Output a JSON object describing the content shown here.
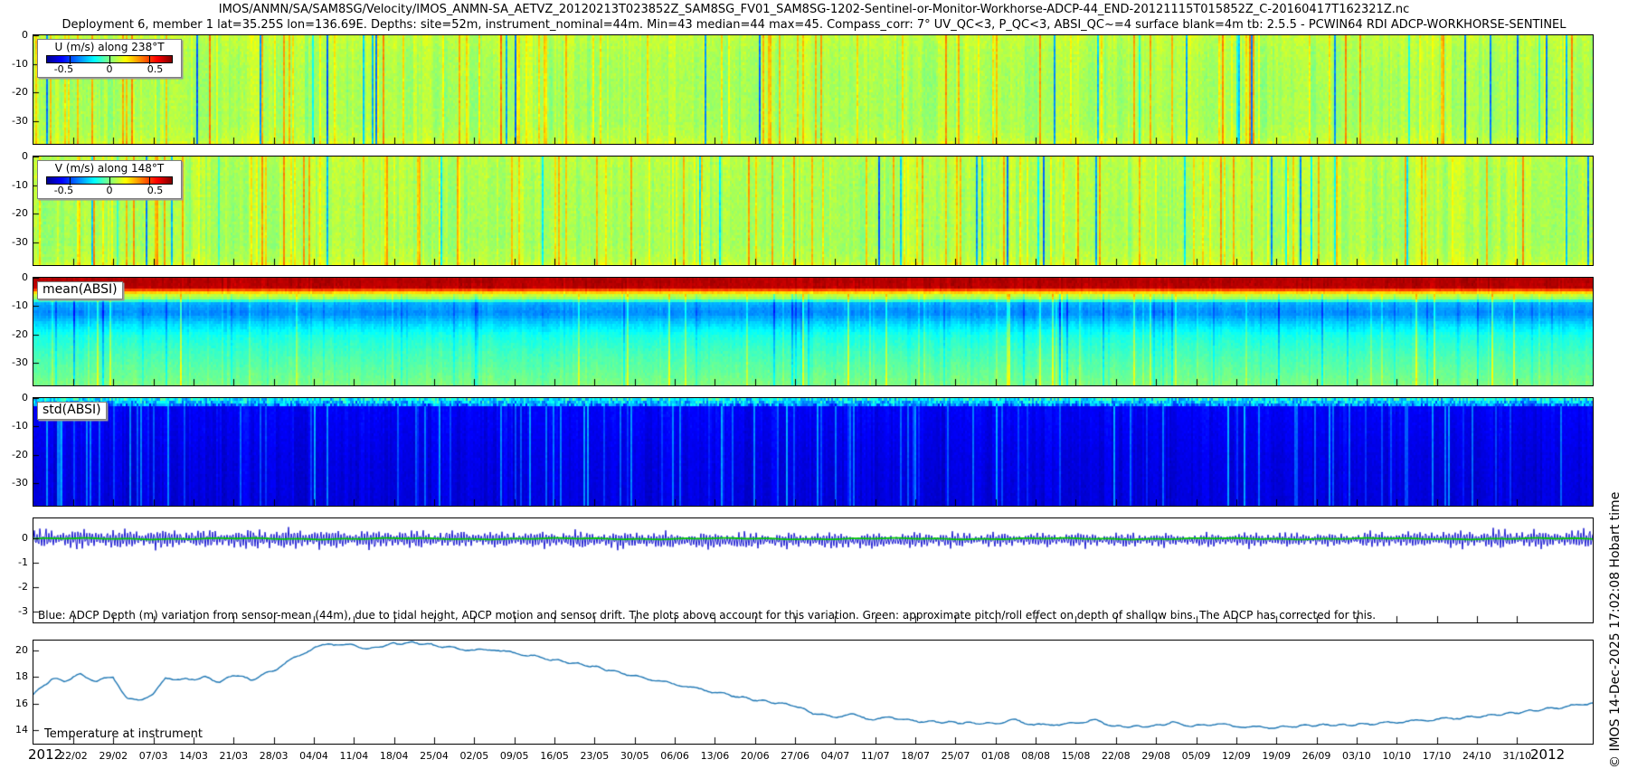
{
  "header": {
    "title": "IMOS/ANMN/SA/SAM8SG/Velocity/IMOS_ANMN-SA_AETVZ_20120213T023852Z_SAM8SG_FV01_SAM8SG-1202-Sentinel-or-Monitor-Workhorse-ADCP-44_END-20121115T015852Z_C-20160417T162321Z.nc",
    "subtitle": "Deployment 6, member 1 lat=35.25S lon=136.69E. Depths: site=52m, instrument_nominal=44m. Min=43 median=44 max=45. Compass_corr: 7° UV_QC<3, P_QC<3, ABSI_QC~=4 surface blank=4m tb: 2.5.5 - PCWIN64 RDI ADCP-WORKHORSE-SENTINEL"
  },
  "watermark": "© IMOS 14-Dec-2025 17:02:08 Hobart time",
  "xaxis": {
    "year_left": "2012",
    "year_right": "2012",
    "tick_labels": [
      "22/02",
      "29/02",
      "07/03",
      "14/03",
      "21/03",
      "28/03",
      "04/04",
      "11/04",
      "18/04",
      "25/04",
      "02/05",
      "09/05",
      "16/05",
      "23/05",
      "30/05",
      "06/06",
      "13/06",
      "20/06",
      "27/06",
      "04/07",
      "11/07",
      "18/07",
      "25/07",
      "01/08",
      "08/08",
      "15/08",
      "22/08",
      "29/08",
      "05/09",
      "12/09",
      "19/09",
      "26/09",
      "03/10",
      "10/10",
      "17/10",
      "24/10",
      "31/10"
    ]
  },
  "chart_data": [
    {
      "id": "u_velocity",
      "type": "heatmap",
      "legend": {
        "title": "U (m/s) along 238°T",
        "ticks": [
          "-0.5",
          "0",
          "0.5"
        ]
      },
      "colormap": "jet",
      "clim": [
        -0.78,
        0.78
      ],
      "ylim": [
        -38,
        0
      ],
      "yticks": [
        0,
        -10,
        -20,
        -30
      ],
      "description": "Depth-time velocity component; mostly weak positive flow (green, ~0 to 0.15 m/s) with full-depth vertical stripes of yellow/orange (~0.3-0.5 m/s) and occasional blue (-0.3 m/s) events",
      "profile": [
        [
          0,
          0.565
        ],
        [
          5,
          0.55
        ],
        [
          15,
          0.54
        ],
        [
          30,
          0.54
        ],
        [
          36,
          0.56
        ],
        [
          38,
          0.6
        ]
      ],
      "noise": {
        "seed": 101,
        "col_sd": 0.05,
        "cell_sd": 0.035,
        "p_hi": 0.1,
        "hi_amp": 0.14,
        "p_lo": 0.04,
        "lo_amp": 0.26,
        "stripe_min_depth": 0,
        "surface_depth": 0,
        "surface_noise": 0
      }
    },
    {
      "id": "v_velocity",
      "type": "heatmap",
      "legend": {
        "title": "V (m/s) along 148°T",
        "ticks": [
          "-0.5",
          "0",
          "0.5"
        ]
      },
      "colormap": "jet",
      "clim": [
        -0.78,
        0.78
      ],
      "ylim": [
        -38,
        0
      ],
      "yticks": [
        0,
        -10,
        -20,
        -30
      ],
      "description": "Depth-time velocity component; similar striped green/yellow field with sporadic orange and blue columns",
      "profile": [
        [
          0,
          0.56
        ],
        [
          5,
          0.55
        ],
        [
          15,
          0.545
        ],
        [
          30,
          0.54
        ],
        [
          36,
          0.56
        ],
        [
          38,
          0.6
        ]
      ],
      "noise": {
        "seed": 202,
        "col_sd": 0.05,
        "cell_sd": 0.035,
        "p_hi": 0.12,
        "hi_amp": 0.13,
        "p_lo": 0.03,
        "lo_amp": 0.24,
        "stripe_min_depth": 0,
        "surface_depth": 0,
        "surface_noise": 0
      }
    },
    {
      "id": "mean_absi",
      "type": "heatmap",
      "label": "mean(ABSI)",
      "colormap": "jet",
      "ylim": [
        -38,
        0
      ],
      "yticks": [
        0,
        -10,
        -20,
        -30
      ],
      "description": "Mean acoustic backscatter: dark-red surface band (0 to -4 m), thin yellow-green band (-4 to -7 m), blue/cyan minimum (-7 to -18 m), teal-green below (-18 to -38 m), all with vertical striping",
      "profile": [
        [
          0,
          0.95
        ],
        [
          3,
          0.94
        ],
        [
          4.5,
          0.7
        ],
        [
          5.5,
          0.58
        ],
        [
          7,
          0.52
        ],
        [
          8.5,
          0.3
        ],
        [
          12,
          0.26
        ],
        [
          16,
          0.34
        ],
        [
          20,
          0.4
        ],
        [
          26,
          0.44
        ],
        [
          32,
          0.47
        ],
        [
          38,
          0.5
        ]
      ],
      "noise": {
        "seed": 303,
        "col_sd": 0.03,
        "cell_sd": 0.025,
        "p_hi": 0.05,
        "hi_amp": 0.1,
        "p_lo": 0.05,
        "lo_amp": 0.08,
        "stripe_min_depth": 5,
        "surface_depth": 0,
        "surface_noise": 0
      }
    },
    {
      "id": "std_absi",
      "type": "heatmap",
      "label": "std(ABSI)",
      "colormap": "jet",
      "ylim": [
        -38,
        0
      ],
      "yticks": [
        0,
        -10,
        -20,
        -30
      ],
      "description": "Backscatter standard deviation: mostly dark blue (low) with lighter-blue vertical stripes and a mixed blue/cyan/green speckled band in the top ~2 m",
      "profile": [
        [
          0,
          0.26
        ],
        [
          1.2,
          0.2
        ],
        [
          2.5,
          0.12
        ],
        [
          20,
          0.1
        ],
        [
          38,
          0.09
        ]
      ],
      "noise": {
        "seed": 404,
        "col_sd": 0.035,
        "cell_sd": 0.02,
        "p_hi": 0.12,
        "hi_amp": 0.13,
        "p_lo": 0.0,
        "lo_amp": 0,
        "stripe_min_depth": 2.5,
        "surface_depth": 2,
        "surface_noise": 0.22
      }
    },
    {
      "id": "depth_variation",
      "type": "line",
      "ylim": [
        -3.46,
        0.84
      ],
      "yticks": [
        0,
        -1,
        -2,
        -3
      ],
      "annotation": "Blue: ADCP Depth (m) variation from sensor-mean (44m), due to tidal height, ADCP motion and sensor drift. The plots above account for this variation. Green: approximate pitch/roll effect on depth of shallow bins. The ADCP has corrected for this.",
      "series": [
        {
          "name": "ADCP depth variation (m)",
          "color": "#0000CC"
        },
        {
          "name": "approximate pitch/roll effect",
          "color": "#00C800"
        }
      ],
      "envelope": [
        [
          0,
          0.3
        ],
        [
          0.05,
          0.35
        ],
        [
          0.1,
          0.3
        ],
        [
          0.15,
          0.35
        ],
        [
          0.2,
          0.32
        ],
        [
          0.25,
          0.3
        ],
        [
          0.3,
          0.28
        ],
        [
          0.35,
          0.3
        ],
        [
          0.4,
          0.28
        ],
        [
          0.45,
          0.3
        ],
        [
          0.47,
          0.25
        ],
        [
          0.52,
          0.28
        ],
        [
          0.58,
          0.25
        ],
        [
          0.63,
          0.22
        ],
        [
          0.68,
          0.25
        ],
        [
          0.73,
          0.22
        ],
        [
          0.78,
          0.25
        ],
        [
          0.83,
          0.22
        ],
        [
          0.88,
          0.28
        ],
        [
          0.93,
          0.32
        ],
        [
          1,
          0.3
        ]
      ],
      "drift": [
        [
          0,
          0
        ],
        [
          0.3,
          -0.02
        ],
        [
          0.45,
          -0.08
        ],
        [
          0.5,
          -0.05
        ],
        [
          0.55,
          -0.08
        ],
        [
          0.6,
          -0.03
        ],
        [
          0.75,
          -0.05
        ],
        [
          1,
          0
        ]
      ],
      "seed": 7
    },
    {
      "id": "temperature",
      "type": "line",
      "label": "Temperature at instrument",
      "ylim": [
        13,
        20.75
      ],
      "yticks": [
        20,
        18,
        16,
        14
      ],
      "series": [
        {
          "name": "Temperature at instrument (°C)",
          "color": "#1f77b4"
        }
      ],
      "points": [
        [
          0,
          16.7
        ],
        [
          0.012,
          17.9
        ],
        [
          0.02,
          17.7
        ],
        [
          0.03,
          18.2
        ],
        [
          0.04,
          17.7
        ],
        [
          0.051,
          18.0
        ],
        [
          0.06,
          16.4
        ],
        [
          0.068,
          16.2
        ],
        [
          0.077,
          16.8
        ],
        [
          0.085,
          17.9
        ],
        [
          0.1,
          17.8
        ],
        [
          0.11,
          18.0
        ],
        [
          0.12,
          17.6
        ],
        [
          0.128,
          18.2
        ],
        [
          0.14,
          17.8
        ],
        [
          0.154,
          18.5
        ],
        [
          0.165,
          19.3
        ],
        [
          0.18,
          20.2
        ],
        [
          0.19,
          20.5
        ],
        [
          0.205,
          20.4
        ],
        [
          0.215,
          20.1
        ],
        [
          0.23,
          20.5
        ],
        [
          0.245,
          20.6
        ],
        [
          0.256,
          20.4
        ],
        [
          0.27,
          20.2
        ],
        [
          0.282,
          20.0
        ],
        [
          0.295,
          20.1
        ],
        [
          0.308,
          19.8
        ],
        [
          0.32,
          19.6
        ],
        [
          0.333,
          19.3
        ],
        [
          0.359,
          18.8
        ],
        [
          0.385,
          18.1
        ],
        [
          0.41,
          17.5
        ],
        [
          0.436,
          16.9
        ],
        [
          0.462,
          16.3
        ],
        [
          0.487,
          15.9
        ],
        [
          0.5,
          15.3
        ],
        [
          0.513,
          15.0
        ],
        [
          0.525,
          15.2
        ],
        [
          0.539,
          14.8
        ],
        [
          0.55,
          15.0
        ],
        [
          0.564,
          14.7
        ],
        [
          0.59,
          14.6
        ],
        [
          0.616,
          14.5
        ],
        [
          0.63,
          14.8
        ],
        [
          0.641,
          14.4
        ],
        [
          0.667,
          14.5
        ],
        [
          0.68,
          14.8
        ],
        [
          0.693,
          14.3
        ],
        [
          0.718,
          14.3
        ],
        [
          0.73,
          14.6
        ],
        [
          0.744,
          14.3
        ],
        [
          0.76,
          14.5
        ],
        [
          0.77,
          14.3
        ],
        [
          0.795,
          14.2
        ],
        [
          0.82,
          14.4
        ],
        [
          0.846,
          14.4
        ],
        [
          0.872,
          14.6
        ],
        [
          0.897,
          14.8
        ],
        [
          0.923,
          15.0
        ],
        [
          0.949,
          15.3
        ],
        [
          0.97,
          15.6
        ],
        [
          0.985,
          15.8
        ],
        [
          1,
          16.1
        ]
      ],
      "seed": 9
    }
  ]
}
